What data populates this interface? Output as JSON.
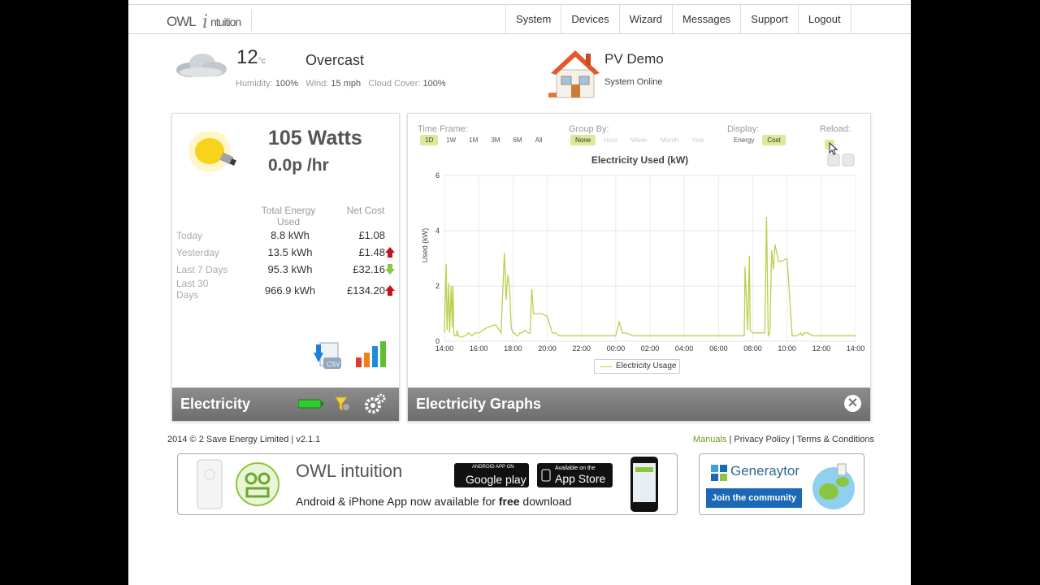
{
  "app": {
    "logo_text": "OWL intuition"
  },
  "nav": [
    "System",
    "Devices",
    "Wizard",
    "Messages",
    "Support",
    "Logout"
  ],
  "weather": {
    "temp": "12",
    "unit": "°c",
    "condition": "Overcast",
    "humidity_label": "Humidity:",
    "humidity": "100%",
    "wind_label": "Wind:",
    "wind": "15 mph",
    "cloud_label": "Cloud Cover:",
    "cloud": "100%"
  },
  "system": {
    "name": "PV Demo",
    "status": "System Online"
  },
  "electricity": {
    "watts": "105 Watts",
    "rate": "0.0p /hr",
    "col_energy": "Total Energy Used",
    "col_cost": "Net Cost",
    "rows": [
      {
        "label": "Today",
        "energy": "8.8 kWh",
        "cost": "£1.08",
        "trend": "none"
      },
      {
        "label": "Yesterday",
        "energy": "13.5 kWh",
        "cost": "£1.48",
        "trend": "up"
      },
      {
        "label": "Last 7 Days",
        "energy": "95.3 kWh",
        "cost": "£32.16",
        "trend": "down"
      },
      {
        "label": "Last 30 Days",
        "energy": "966.9 kWh",
        "cost": "£134.20",
        "trend": "up"
      }
    ],
    "footer_title": "Electricity"
  },
  "graphs": {
    "footer_title": "Electricity Graphs",
    "timeframe_label": "Time Frame:",
    "timeframe": [
      "1D",
      "1W",
      "1M",
      "3M",
      "6M",
      "All"
    ],
    "groupby_label": "Group By:",
    "groupby": [
      "None",
      "Hour",
      "Week",
      "Month",
      "Year"
    ],
    "display_label": "Display:",
    "display": [
      "Energy",
      "Cost"
    ],
    "reload_label": "Reload:"
  },
  "chart_data": {
    "type": "line",
    "title": "Electricity Used (kW)",
    "ylabel": "Used (kW)",
    "ylim": [
      0,
      6
    ],
    "yticks": [
      "0",
      "2",
      "4",
      "6"
    ],
    "xticks": [
      "14:00",
      "16:00",
      "18:00",
      "20:00",
      "22:00",
      "00:00",
      "02:00",
      "04:00",
      "06:00",
      "08:00",
      "10:00",
      "12:00",
      "14:00"
    ],
    "xlim": [
      0,
      24
    ],
    "series": [
      {
        "name": "Electricity Usage",
        "color": "#b7d24c",
        "x": [
          0,
          0.1,
          0.15,
          0.25,
          0.3,
          0.4,
          0.45,
          0.5,
          0.55,
          0.6,
          0.7,
          0.75,
          0.8,
          1.0,
          1.2,
          1.4,
          1.6,
          1.8,
          2.0,
          2.5,
          3.0,
          3.3,
          3.5,
          3.6,
          3.7,
          3.8,
          3.9,
          4.0,
          4.1,
          4.2,
          4.3,
          4.4,
          4.5,
          4.7,
          4.9,
          5.0,
          5.1,
          5.2,
          5.4,
          5.7,
          6.0,
          6.3,
          6.5,
          6.7,
          7.0,
          7.3,
          7.6,
          8.0,
          8.5,
          9.0,
          9.5,
          10.0,
          10.2,
          10.4,
          10.6,
          11.0,
          11.5,
          12.0,
          12.5,
          13.0,
          13.5,
          14.0,
          14.5,
          15.0,
          15.5,
          16.0,
          16.5,
          17.0,
          17.3,
          17.5,
          17.55,
          17.7,
          17.8,
          17.85,
          18.0,
          18.3,
          18.6,
          18.7,
          18.8,
          18.9,
          19.0,
          19.1,
          19.2,
          19.3,
          19.4,
          19.5,
          19.7,
          20.0,
          20.3,
          20.6,
          20.8,
          20.9,
          21.0,
          21.2,
          21.5,
          22.0,
          22.5,
          23.0,
          23.5,
          24.0
        ],
        "y": [
          0.3,
          2.8,
          0.4,
          2.1,
          0.3,
          2.0,
          0.5,
          2.0,
          0.3,
          0.2,
          0.2,
          0.4,
          0.2,
          0.15,
          0.2,
          0.3,
          0.2,
          0.3,
          0.3,
          0.5,
          0.6,
          0.3,
          3.2,
          1.5,
          2.4,
          2.0,
          0.5,
          0.3,
          0.3,
          0.2,
          0.2,
          0.3,
          0.3,
          0.4,
          0.3,
          0.3,
          1.9,
          1.0,
          1.0,
          1.0,
          0.9,
          0.3,
          0.3,
          0.2,
          0.2,
          0.2,
          0.2,
          0.2,
          0.2,
          0.2,
          0.2,
          0.2,
          0.7,
          0.3,
          0.3,
          0.2,
          0.2,
          0.2,
          0.2,
          0.2,
          0.2,
          0.2,
          0.2,
          0.2,
          0.2,
          0.2,
          0.2,
          0.2,
          0.2,
          0.2,
          2.7,
          0.4,
          3.1,
          0.4,
          0.3,
          0.3,
          0.3,
          0.3,
          4.5,
          0.2,
          0.3,
          3.3,
          2.6,
          3.5,
          3.2,
          2.9,
          2.9,
          3.0,
          0.2,
          0.2,
          0.3,
          0.2,
          0.3,
          0.3,
          0.2,
          0.2,
          0.2,
          0.2,
          0.2,
          0.2
        ]
      }
    ]
  },
  "footer": {
    "copyright": "2014 © 2 Save Energy Limited | v2.1.1",
    "links": [
      "Manuals",
      "Privacy Policy",
      "Terms & Conditions"
    ],
    "separator": "|",
    "banner_logo": "OWL intuition",
    "banner_msg_a": "Android & iPhone App now available for",
    "banner_msg_b": "free",
    "banner_msg_c": "download",
    "google_small": "ANDROID APP ON",
    "google_big": "Google play",
    "apple_small": "Available on the",
    "apple_big": "App Store",
    "generaytor": "Generaytor",
    "join": "Join the community"
  }
}
